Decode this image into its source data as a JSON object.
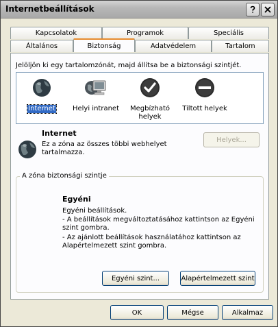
{
  "window": {
    "title": "Internetbeállítások"
  },
  "tabs": {
    "row_back": [
      "Kapcsolatok",
      "Programok",
      "Speciális"
    ],
    "row_front": [
      "Általános",
      "Biztonság",
      "Adatvédelem",
      "Tartalom"
    ],
    "active": "Biztonság"
  },
  "security": {
    "instruction": "Jelöljön ki egy tartalomzónát, majd állítsa be a biztonsági szintjét.",
    "zones": [
      {
        "label": "Internet",
        "icon": "globe-icon"
      },
      {
        "label": "Helyi intranet",
        "icon": "computer-icon"
      },
      {
        "label": "Megbízható helyek",
        "icon": "checkmark-icon"
      },
      {
        "label": "Tiltott helyek",
        "icon": "no-entry-icon"
      }
    ],
    "selected_zone": "Internet",
    "zone_title": "Internet",
    "zone_description": "Ez a zóna az összes többi webhelyet tartalmazza.",
    "sites_button": "Helyek...",
    "level_group_label": "A zóna biztonsági szintje",
    "level_title": "Egyéni",
    "level_lines": [
      "Egyéni beállítások.",
      "- A beállítások megváltoztatásához kattintson az Egyéni szint gombra.",
      "- Az ajánlott beállítások használatához kattintson az Alapértelmezett szint gombra."
    ],
    "custom_level_button": "Egyéni szint...",
    "default_level_button": "Alapértelmezett szint"
  },
  "footer": {
    "ok": "OK",
    "cancel": "Mégse",
    "apply": "Alkalmaz"
  }
}
